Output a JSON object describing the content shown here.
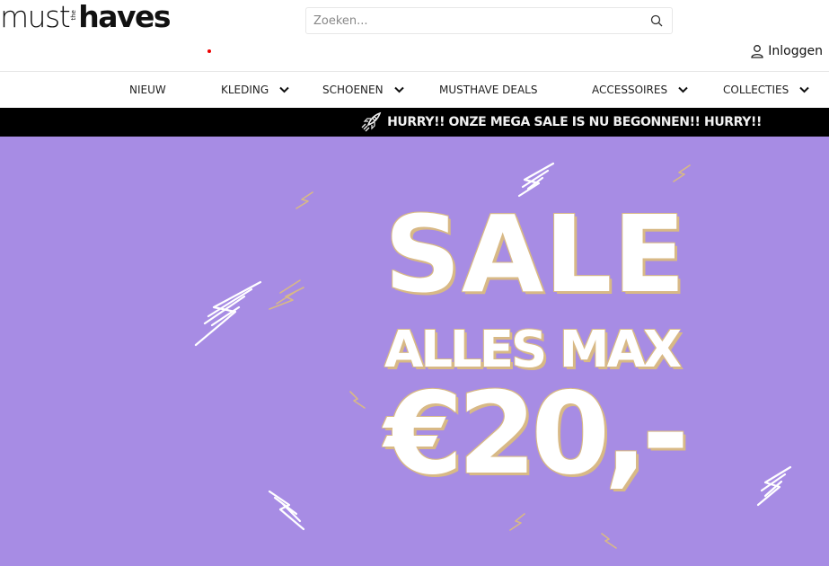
{
  "logo": {
    "part1": "must",
    "the": "the",
    "part2": "haves"
  },
  "search": {
    "placeholder": "Zoeken..."
  },
  "account": {
    "login_label": "Inloggen"
  },
  "nav": {
    "items": [
      {
        "label": "NIEUW",
        "has_dropdown": false
      },
      {
        "label": "KLEDING",
        "has_dropdown": true
      },
      {
        "label": "SCHOENEN",
        "has_dropdown": true
      },
      {
        "label": "MUSTHAVE DEALS",
        "has_dropdown": false
      },
      {
        "label": "ACCESSOIRES",
        "has_dropdown": true
      },
      {
        "label": "COLLECTIES",
        "has_dropdown": true
      }
    ]
  },
  "ticker": {
    "text": "HURRY!! ONZE MEGA SALE IS NU BEGONNEN!! HURRY!!",
    "icon": "rocket-icon"
  },
  "hero": {
    "line1": "SALE",
    "line2": "ALLES MAX",
    "line3": "€20,-",
    "background": "#a78ce4",
    "accent": "#d8b986"
  }
}
